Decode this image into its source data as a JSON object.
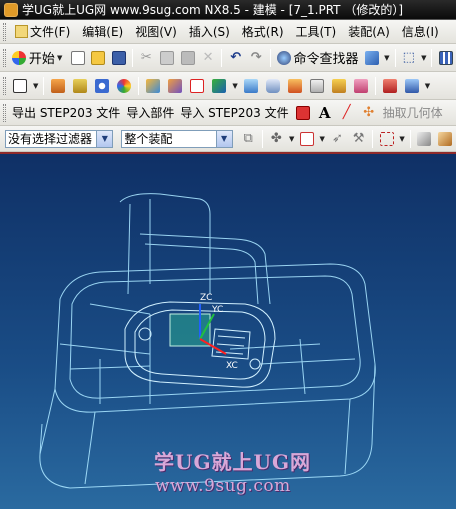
{
  "titlebar": {
    "title": "学UG就上UG网 www.9sug.com NX8.5 - 建模 - [7_1.PRT （修改的）]"
  },
  "menubar": {
    "items": [
      {
        "label": "文件(F)",
        "icon": "file-menu-icon"
      },
      {
        "label": "编辑(E)"
      },
      {
        "label": "视图(V)"
      },
      {
        "label": "插入(S)"
      },
      {
        "label": "格式(R)"
      },
      {
        "label": "工具(T)"
      },
      {
        "label": "装配(A)"
      },
      {
        "label": "信息(I)"
      }
    ]
  },
  "toolbar1": {
    "start_label": "开始",
    "command_finder_label": "命令查找器"
  },
  "toolbar3": {
    "export_step_label": "导出 STEP203 文件",
    "import_part_label": "导入部件",
    "import_step_label": "导入 STEP203 文件",
    "extract_geometry_label": "抽取几何体"
  },
  "toolbar4": {
    "filter_value": "没有选择过滤器",
    "assembly_value": "整个装配"
  },
  "viewport": {
    "watermark_line1": "学UG就上UG网",
    "watermark_line2": "www.9sug.com",
    "axis_z": "ZC",
    "axis_y": "YC",
    "axis_x": "XC",
    "colors": {
      "wireframe": "#a8e4ff",
      "axis_z": "#2060ff",
      "axis_y": "#20c040",
      "axis_x": "#ff2020",
      "background_top": "#0f3066",
      "background_bottom": "#2a6aa0"
    }
  }
}
